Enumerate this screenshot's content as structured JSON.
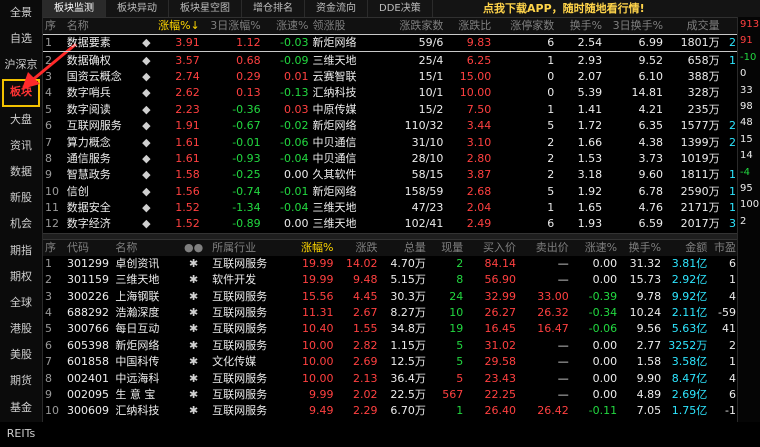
{
  "sidebar": [
    "全景",
    "自选",
    "沪深京",
    "板块",
    "大盘",
    "资讯",
    "数据",
    "新股",
    "机会",
    "期指",
    "期权",
    "全球",
    "港股",
    "美股",
    "期货",
    "基金",
    "REITs"
  ],
  "tabs": [
    "板块监测",
    "板块异动",
    "板块星空图",
    "增仓排名",
    "资金流向",
    "DDE决策"
  ],
  "promo": "点我下载APP，随时随地看行情!",
  "sector_headers": [
    "序",
    "名称",
    "",
    "涨幅%↓",
    "3日涨幅%",
    "涨速%",
    "领涨股",
    "涨跌家数",
    "涨跌比",
    "涨停家数",
    "换手%",
    "3日换手%",
    "成交量"
  ],
  "sectors": [
    [
      "1",
      "数据要素",
      "3.91",
      "1.12",
      "-0.03",
      "新炬网络",
      "59/6",
      "9.83",
      "6",
      "2.54",
      "6.99",
      "1801万",
      "2"
    ],
    [
      "2",
      "数据确权",
      "3.57",
      "0.68",
      "-0.09",
      "三维天地",
      "25/4",
      "6.25",
      "1",
      "2.93",
      "9.52",
      "658万",
      "1"
    ],
    [
      "3",
      "国资云概念",
      "2.74",
      "0.29",
      "0.01",
      "云赛智联",
      "15/1",
      "15.00",
      "0",
      "2.07",
      "6.10",
      "388万",
      ""
    ],
    [
      "4",
      "数字哨兵",
      "2.62",
      "0.13",
      "-0.13",
      "汇纳科技",
      "10/1",
      "10.00",
      "0",
      "5.39",
      "14.81",
      "328万",
      ""
    ],
    [
      "5",
      "数字阅读",
      "2.23",
      "-0.36",
      "0.03",
      "中原传媒",
      "15/2",
      "7.50",
      "1",
      "1.41",
      "4.21",
      "235万",
      ""
    ],
    [
      "6",
      "互联网服务",
      "1.91",
      "-0.67",
      "-0.02",
      "新炬网络",
      "110/32",
      "3.44",
      "5",
      "1.72",
      "6.35",
      "1577万",
      "2"
    ],
    [
      "7",
      "算力概念",
      "1.61",
      "-0.01",
      "-0.06",
      "中贝通信",
      "31/10",
      "3.10",
      "2",
      "1.66",
      "4.38",
      "1399万",
      "2"
    ],
    [
      "8",
      "通信服务",
      "1.61",
      "-0.93",
      "-0.04",
      "中贝通信",
      "28/10",
      "2.80",
      "2",
      "1.53",
      "3.73",
      "1019万",
      ""
    ],
    [
      "9",
      "智慧政务",
      "1.58",
      "-0.25",
      "0.00",
      "久其软件",
      "58/15",
      "3.87",
      "2",
      "3.18",
      "9.60",
      "1811万",
      "1"
    ],
    [
      "10",
      "信创",
      "1.56",
      "-0.74",
      "-0.01",
      "新炬网络",
      "158/59",
      "2.68",
      "5",
      "1.92",
      "6.78",
      "2590万",
      "1"
    ],
    [
      "11",
      "数据安全",
      "1.52",
      "-1.34",
      "-0.04",
      "三维天地",
      "47/23",
      "2.04",
      "1",
      "1.65",
      "4.76",
      "2171万",
      "1"
    ],
    [
      "12",
      "数字经济",
      "1.52",
      "-0.89",
      "0.00",
      "三维天地",
      "102/41",
      "2.49",
      "6",
      "1.93",
      "6.59",
      "2017万",
      "3"
    ]
  ],
  "stock_headers": [
    "序",
    "代码",
    "名称",
    "●●",
    "所属行业",
    "涨幅%",
    "涨跌",
    "总量",
    "现量",
    "买入价",
    "卖出价",
    "涨速%",
    "换手%",
    "金额",
    "市盈"
  ],
  "stocks": [
    [
      "1",
      "301299",
      "卓创资讯",
      "",
      "互联网服务",
      "19.99",
      "14.02",
      "4.70万",
      "2",
      "84.14",
      "—",
      "0.00",
      "31.32",
      "3.81亿",
      "6"
    ],
    [
      "2",
      "301159",
      "三维天地",
      "",
      "软件开发",
      "19.99",
      "9.48",
      "5.15万",
      "8",
      "56.90",
      "—",
      "0.00",
      "15.73",
      "2.92亿",
      "1"
    ],
    [
      "3",
      "300226",
      "上海钢联",
      "",
      "互联网服务",
      "15.56",
      "4.45",
      "30.3万",
      "24",
      "32.99",
      "33.00",
      "-0.39",
      "9.78",
      "9.92亿",
      "4"
    ],
    [
      "4",
      "688292",
      "浩瀚深度",
      "",
      "互联网服务",
      "11.31",
      "2.67",
      "8.27万",
      "10",
      "26.27",
      "26.32",
      "-0.34",
      "10.24",
      "2.11亿",
      "-59"
    ],
    [
      "5",
      "300766",
      "每日互动",
      "",
      "互联网服务",
      "10.40",
      "1.55",
      "34.8万",
      "19",
      "16.45",
      "16.47",
      "-0.06",
      "9.56",
      "5.63亿",
      "41"
    ],
    [
      "6",
      "605398",
      "新炬网络",
      "",
      "互联网服务",
      "10.00",
      "2.82",
      "1.15万",
      "5",
      "31.02",
      "—",
      "0.00",
      "2.77",
      "3252万",
      "2"
    ],
    [
      "7",
      "601858",
      "中国科传",
      "",
      "文化传媒",
      "10.00",
      "2.69",
      "12.5万",
      "5",
      "29.58",
      "—",
      "0.00",
      "1.58",
      "3.58亿",
      "1"
    ],
    [
      "8",
      "002401",
      "中远海科",
      "",
      "互联网服务",
      "10.00",
      "2.13",
      "36.4万",
      "5",
      "23.43",
      "—",
      "0.00",
      "9.90",
      "8.47亿",
      "4"
    ],
    [
      "9",
      "002095",
      "生 意 宝",
      "",
      "互联网服务",
      "9.99",
      "2.02",
      "22.5万",
      "567",
      "22.25",
      "—",
      "0.00",
      "4.89",
      "2.69亿",
      "6"
    ],
    [
      "10",
      "300609",
      "汇纳科技",
      "",
      "互联网服务",
      "9.49",
      "2.29",
      "6.70万",
      "1",
      "26.40",
      "26.42",
      "-0.11",
      "7.05",
      "1.75亿",
      "-1"
    ]
  ],
  "right_scroll": [
    "913",
    "91",
    "-10",
    "0",
    "33",
    "98",
    "48",
    "15",
    "14",
    "-4",
    "95",
    "100",
    "2"
  ]
}
